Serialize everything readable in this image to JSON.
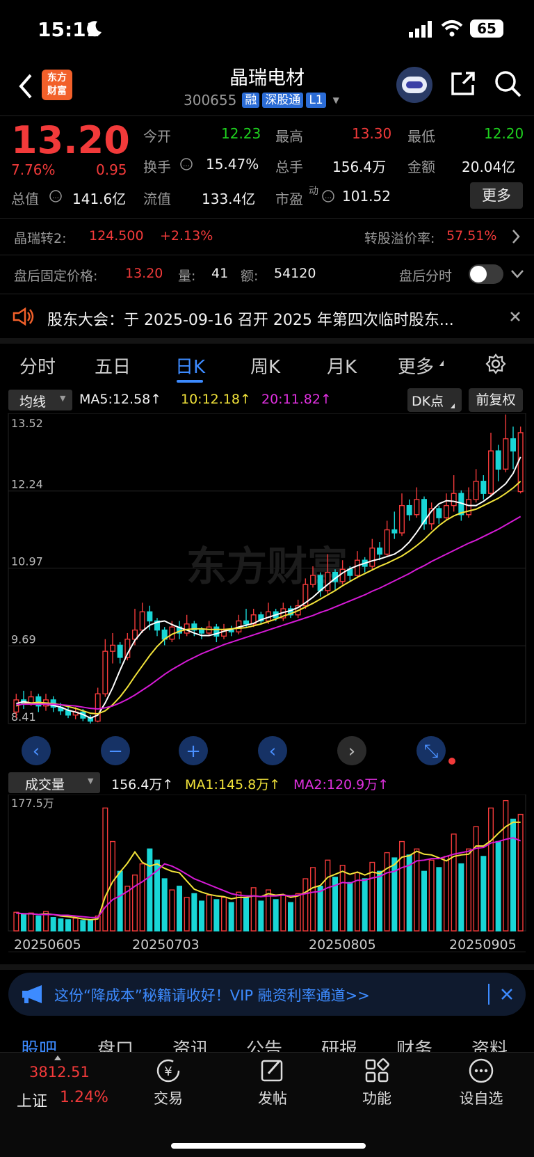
{
  "status": {
    "time": "15:11",
    "moon_icon": "moon-icon",
    "battery": "65"
  },
  "header": {
    "title": "晶瑞电材",
    "code": "300655",
    "tags": [
      "融",
      "深股通",
      "L1"
    ],
    "logo_line1": "东方",
    "logo_line2": "财富"
  },
  "quote": {
    "price": "13.20",
    "pct": "7.76%",
    "chg": "0.95",
    "open_label": "今开",
    "open": "12.23",
    "high_label": "最高",
    "high": "13.30",
    "low_label": "最低",
    "low": "12.20",
    "turnover_label": "换手",
    "turnover": "15.47%",
    "volume_label": "总手",
    "volume": "156.4万",
    "amount_label": "金额",
    "amount": "20.04亿",
    "mcap_label": "总值",
    "mcap": "141.6亿",
    "float_label": "流值",
    "float": "133.4亿",
    "pe_label": "市盈",
    "pe_sup": "动",
    "pe": "101.52",
    "more": "更多"
  },
  "bond": {
    "name": "晶瑞转2:",
    "price": "124.500",
    "pct": "+2.13%",
    "premium_label": "转股溢价率:",
    "premium": "57.51%"
  },
  "afterhours": {
    "label": "盘后固定价格:",
    "price": "13.20",
    "vol_label": "量:",
    "vol": "41",
    "amt_label": "额:",
    "amt": "54120",
    "switch_label": "盘后分时"
  },
  "notice": {
    "text": "股东大会：于 2025-09-16 召开 2025 年第四次临时股东..."
  },
  "tabs": [
    "分时",
    "五日",
    "日K",
    "周K",
    "月K",
    "更多"
  ],
  "ma_bar": {
    "selector": "均线",
    "ma5": "MA5:12.58↑",
    "ma10": "10:12.18↑",
    "ma20": "20:11.82↑",
    "dk": "DK点",
    "adjust": "前复权"
  },
  "watermark": "东方财富",
  "vol_bar": {
    "selector": "成交量",
    "v": "156.4万↑",
    "ma1": "MA1:145.8万↑",
    "ma2": "MA2:120.9万↑"
  },
  "promo": {
    "text": "这份“降成本”秘籍请收好！VIP 融资利率通道>>"
  },
  "subtabs": [
    "股吧",
    "盘口",
    "资讯",
    "公告",
    "研报",
    "财务",
    "资料"
  ],
  "bottom": {
    "index_value": "3812.51",
    "index_name": "上证",
    "index_pct": "1.24%",
    "items": [
      "交易",
      "发帖",
      "功能",
      "设自选"
    ]
  },
  "colors": {
    "up": "#f23a3a",
    "down": "#19d6d6",
    "ma5": "#ffffff",
    "ma10": "#f2e33a",
    "ma20": "#d61ad6"
  },
  "chart_data": [
    {
      "type": "candlestick",
      "y_ticks": [
        "13.52",
        "12.24",
        "10.97",
        "9.69",
        "8.41"
      ],
      "ylim": [
        8.41,
        13.52
      ],
      "x_ticks": [
        "20250605",
        "20250703",
        "20250805",
        "20250905"
      ],
      "series": [
        {
          "name": "MA5",
          "values": [
            8.74,
            8.77,
            8.75,
            8.74,
            8.73,
            8.71,
            8.68,
            8.63,
            8.6,
            8.56,
            8.5,
            8.55,
            8.75,
            9.0,
            9.29,
            9.56,
            9.78,
            9.93,
            10.03,
            10.08,
            10.1,
            10.04,
            9.99,
            9.95,
            9.9,
            9.86,
            9.86,
            9.89,
            9.93,
            9.96,
            10.0,
            10.03,
            10.06,
            10.12,
            10.16,
            10.2,
            10.24,
            10.27,
            10.32,
            10.4,
            10.49,
            10.6,
            10.7,
            10.8,
            10.89,
            10.96,
            11.01,
            11.05,
            11.09,
            11.12,
            11.16,
            11.2,
            11.28,
            11.4,
            11.56,
            11.74,
            11.91,
            12.03,
            12.08,
            12.07,
            12.04,
            12.0,
            12.0,
            12.07,
            12.16,
            12.26,
            12.36,
            12.53,
            12.8
          ]
        },
        {
          "name": "MA10",
          "values": [
            8.7,
            8.74,
            8.75,
            8.76,
            8.75,
            8.74,
            8.72,
            8.69,
            8.66,
            8.62,
            8.58,
            8.57,
            8.62,
            8.72,
            8.85,
            9.01,
            9.19,
            9.36,
            9.53,
            9.68,
            9.8,
            9.88,
            9.93,
            9.96,
            9.97,
            9.97,
            9.96,
            9.96,
            9.96,
            9.97,
            9.98,
            9.99,
            10.02,
            10.05,
            10.09,
            10.13,
            10.18,
            10.22,
            10.27,
            10.33,
            10.39,
            10.46,
            10.53,
            10.6,
            10.68,
            10.75,
            10.82,
            10.88,
            10.94,
            11.0,
            11.05,
            11.11,
            11.17,
            11.25,
            11.34,
            11.44,
            11.56,
            11.67,
            11.76,
            11.83,
            11.88,
            11.91,
            11.94,
            12.0,
            12.06,
            12.12,
            12.2,
            12.29,
            12.4
          ]
        },
        {
          "name": "MA20",
          "values": [
            8.72,
            8.73,
            8.73,
            8.73,
            8.73,
            8.73,
            8.72,
            8.71,
            8.7,
            8.68,
            8.66,
            8.65,
            8.67,
            8.7,
            8.75,
            8.81,
            8.88,
            8.96,
            9.04,
            9.13,
            9.22,
            9.3,
            9.37,
            9.44,
            9.5,
            9.56,
            9.61,
            9.66,
            9.71,
            9.75,
            9.79,
            9.83,
            9.87,
            9.91,
            9.95,
            9.99,
            10.03,
            10.07,
            10.11,
            10.15,
            10.19,
            10.24,
            10.28,
            10.33,
            10.38,
            10.43,
            10.48,
            10.53,
            10.59,
            10.64,
            10.7,
            10.76,
            10.82,
            10.88,
            10.95,
            11.01,
            11.08,
            11.14,
            11.2,
            11.26,
            11.32,
            11.38,
            11.43,
            11.49,
            11.55,
            11.61,
            11.68,
            11.75,
            11.82
          ]
        }
      ],
      "candles": [
        [
          8.6,
          8.8,
          8.9,
          8.5
        ],
        [
          8.8,
          8.75,
          8.95,
          8.65
        ],
        [
          8.75,
          8.85,
          8.95,
          8.7
        ],
        [
          8.85,
          8.7,
          8.9,
          8.6
        ],
        [
          8.7,
          8.8,
          8.9,
          8.62
        ],
        [
          8.8,
          8.68,
          8.86,
          8.6
        ],
        [
          8.68,
          8.62,
          8.75,
          8.55
        ],
        [
          8.62,
          8.55,
          8.7,
          8.5
        ],
        [
          8.55,
          8.6,
          8.68,
          8.48
        ],
        [
          8.6,
          8.5,
          8.65,
          8.45
        ],
        [
          8.5,
          8.45,
          8.55,
          8.41
        ],
        [
          8.45,
          8.9,
          9.0,
          8.43
        ],
        [
          8.9,
          9.6,
          9.8,
          8.85
        ],
        [
          9.6,
          9.7,
          9.9,
          9.4
        ],
        [
          9.7,
          9.5,
          9.75,
          9.4
        ],
        [
          9.5,
          9.8,
          9.9,
          9.45
        ],
        [
          9.8,
          9.95,
          10.3,
          9.7
        ],
        [
          9.95,
          10.25,
          10.4,
          9.9
        ],
        [
          10.25,
          10.1,
          10.35,
          9.95
        ],
        [
          10.1,
          9.95,
          10.15,
          9.85
        ],
        [
          9.95,
          9.8,
          10.0,
          9.7
        ],
        [
          9.8,
          10.0,
          10.1,
          9.75
        ],
        [
          10.0,
          9.9,
          10.1,
          9.8
        ],
        [
          9.9,
          10.05,
          10.2,
          9.85
        ],
        [
          10.05,
          9.95,
          10.1,
          9.85
        ],
        [
          9.95,
          9.9,
          10.0,
          9.8
        ],
        [
          9.9,
          10.0,
          10.1,
          9.85
        ],
        [
          10.0,
          9.85,
          10.05,
          9.75
        ],
        [
          9.85,
          9.95,
          10.05,
          9.8
        ],
        [
          9.95,
          9.92,
          10.02,
          9.85
        ],
        [
          9.92,
          10.1,
          10.2,
          9.88
        ],
        [
          10.1,
          10.05,
          10.3,
          10.0
        ],
        [
          10.05,
          10.2,
          10.3,
          10.0
        ],
        [
          10.2,
          10.1,
          10.25,
          10.05
        ],
        [
          10.1,
          10.25,
          10.4,
          10.05
        ],
        [
          10.25,
          10.15,
          10.3,
          10.1
        ],
        [
          10.15,
          10.3,
          10.4,
          10.1
        ],
        [
          10.3,
          10.2,
          10.35,
          10.15
        ],
        [
          10.2,
          10.35,
          10.45,
          10.15
        ],
        [
          10.35,
          10.7,
          10.8,
          10.3
        ],
        [
          10.7,
          10.85,
          11.0,
          10.65
        ],
        [
          10.85,
          10.6,
          10.9,
          10.5
        ],
        [
          10.6,
          10.9,
          11.2,
          10.55
        ],
        [
          10.9,
          10.75,
          10.95,
          10.6
        ],
        [
          10.75,
          10.95,
          11.1,
          10.7
        ],
        [
          10.95,
          10.85,
          11.0,
          10.75
        ],
        [
          10.85,
          11.1,
          11.25,
          10.8
        ],
        [
          11.1,
          11.0,
          11.15,
          10.9
        ],
        [
          11.0,
          11.3,
          11.45,
          10.95
        ],
        [
          11.3,
          11.2,
          11.4,
          11.1
        ],
        [
          11.2,
          11.6,
          11.75,
          11.15
        ],
        [
          11.6,
          11.55,
          11.9,
          11.45
        ],
        [
          11.55,
          12.0,
          12.2,
          11.5
        ],
        [
          12.0,
          11.85,
          12.1,
          11.75
        ],
        [
          11.85,
          12.1,
          12.3,
          11.8
        ],
        [
          12.1,
          11.7,
          12.15,
          11.6
        ],
        [
          11.7,
          11.95,
          12.05,
          11.6
        ],
        [
          11.95,
          11.8,
          12.0,
          11.7
        ],
        [
          11.8,
          12.0,
          12.2,
          11.75
        ],
        [
          12.0,
          12.2,
          12.5,
          11.9
        ],
        [
          12.2,
          11.85,
          12.25,
          11.75
        ],
        [
          11.85,
          12.1,
          12.3,
          11.8
        ],
        [
          12.1,
          12.4,
          12.6,
          12.05
        ],
        [
          12.4,
          12.2,
          12.5,
          12.1
        ],
        [
          12.2,
          12.9,
          13.2,
          12.15
        ],
        [
          12.9,
          12.6,
          13.0,
          12.4
        ],
        [
          12.6,
          13.1,
          13.5,
          12.55
        ],
        [
          13.1,
          12.9,
          13.3,
          12.6
        ],
        [
          12.23,
          13.2,
          13.3,
          12.2
        ]
      ]
    },
    {
      "type": "bar",
      "title": "成交量",
      "y_ticks": [
        "177.5万"
      ],
      "ylim": [
        0,
        177.5
      ],
      "series": [
        {
          "name": "volume",
          "values": [
            25,
            22,
            24,
            20,
            26,
            18,
            16,
            15,
            17,
            14,
            15,
            20,
            165,
            120,
            80,
            60,
            75,
            90,
            110,
            95,
            70,
            55,
            60,
            45,
            50,
            40,
            48,
            42,
            45,
            38,
            52,
            44,
            58,
            40,
            55,
            42,
            48,
            38,
            50,
            70,
            85,
            60,
            95,
            72,
            88,
            65,
            78,
            70,
            92,
            80,
            105,
            98,
            120,
            102,
            110,
            80,
            95,
            85,
            100,
            130,
            90,
            110,
            140,
            100,
            165,
            120,
            175,
            150,
            156.4
          ]
        },
        {
          "name": "MA1",
          "values": [
            24,
            23,
            23,
            22,
            23,
            22,
            20,
            19,
            18,
            16,
            15,
            16,
            46,
            66,
            79,
            91,
            106,
            92,
            87,
            90,
            84,
            80,
            78,
            67,
            56,
            52,
            49,
            47,
            46,
            43,
            45,
            45,
            47,
            46,
            50,
            48,
            49,
            45,
            47,
            52,
            58,
            61,
            72,
            76,
            80,
            76,
            79,
            75,
            79,
            77,
            84,
            89,
            99,
            101,
            107,
            103,
            102,
            98,
            94,
            100,
            102,
            103,
            114,
            114,
            121,
            131,
            140,
            146,
            145.8
          ]
        },
        {
          "name": "MA2",
          "values": [
            24,
            23,
            23,
            22,
            22,
            22,
            21,
            21,
            20,
            19,
            18,
            18,
            32,
            42,
            47,
            53,
            60,
            66,
            73,
            81,
            90,
            87,
            82,
            76,
            70,
            66,
            62,
            58,
            54,
            50,
            48,
            47,
            47,
            46,
            47,
            47,
            48,
            47,
            48,
            50,
            52,
            53,
            58,
            61,
            65,
            64,
            68,
            68,
            71,
            73,
            78,
            80,
            85,
            88,
            94,
            95,
            97,
            97,
            100,
            103,
            105,
            107,
            111,
            112,
            118,
            120,
            123,
            125,
            120.9
          ]
        }
      ]
    }
  ]
}
